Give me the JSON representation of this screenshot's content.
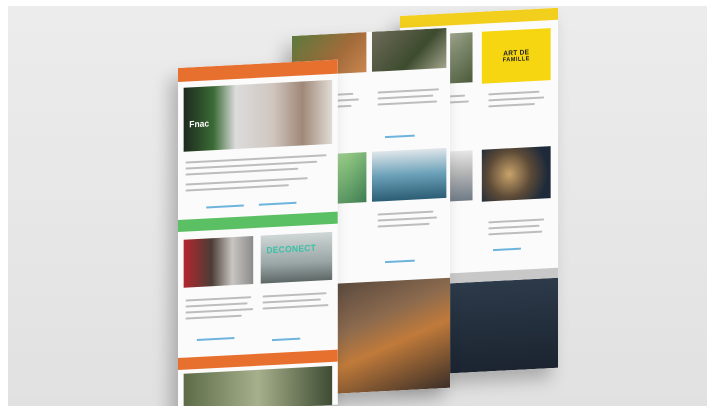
{
  "mockup": {
    "back_page": {
      "header_color": "#f3cf1d",
      "brand_logo_text_line1": "ART DE",
      "brand_logo_text_line2": "FAMILLE"
    },
    "front_page": {
      "header_color": "#e8702f",
      "section_green_color": "#5bbf63",
      "photo_sign_text": "Fnac",
      "photo_screen_text": "DECONECT"
    }
  }
}
